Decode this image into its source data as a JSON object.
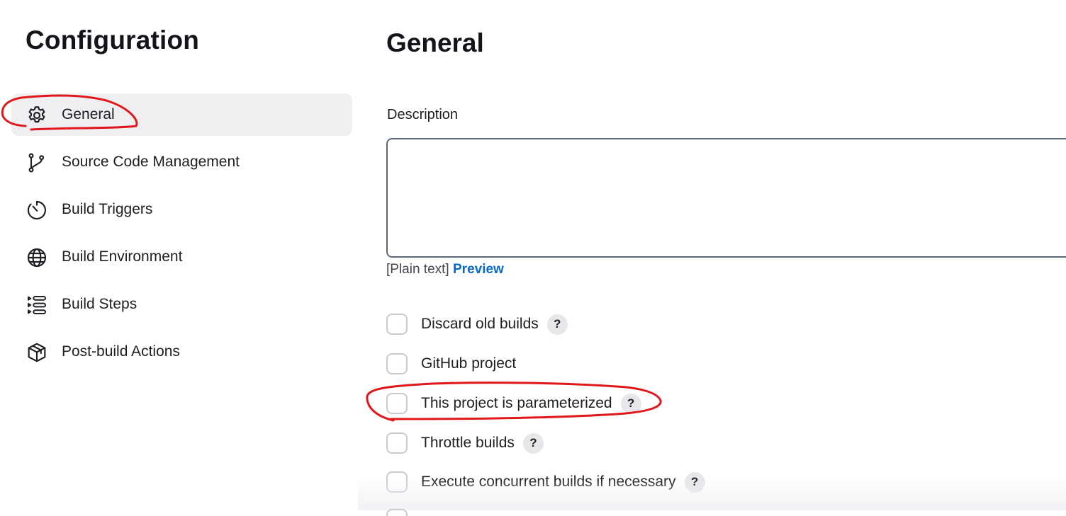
{
  "sidebar": {
    "title": "Configuration",
    "items": [
      {
        "label": "General",
        "icon": "gear-icon",
        "active": true
      },
      {
        "label": "Source Code Management",
        "icon": "git-branch-icon",
        "active": false
      },
      {
        "label": "Build Triggers",
        "icon": "timer-icon",
        "active": false
      },
      {
        "label": "Build Environment",
        "icon": "globe-icon",
        "active": false
      },
      {
        "label": "Build Steps",
        "icon": "list-steps-icon",
        "active": false
      },
      {
        "label": "Post-build Actions",
        "icon": "package-icon",
        "active": false
      }
    ]
  },
  "main": {
    "title": "General",
    "description": {
      "label": "Description",
      "value": "",
      "format_text": "[Plain text]",
      "preview_link": "Preview"
    },
    "options": [
      {
        "label": "Discard old builds",
        "checked": false,
        "help": "?"
      },
      {
        "label": "GitHub project",
        "checked": false,
        "help": ""
      },
      {
        "label": "This project is parameterized",
        "checked": false,
        "help": "?"
      },
      {
        "label": "Throttle builds",
        "checked": false,
        "help": "?"
      },
      {
        "label": "Execute concurrent builds if necessary",
        "checked": false,
        "help": "?"
      }
    ]
  },
  "colors": {
    "active_bg": "#efeff2",
    "link": "#0b6ac9",
    "annotation": "#e0181c",
    "textarea_border": "#5d6a76",
    "checkbox_border": "#c6cbd1"
  }
}
